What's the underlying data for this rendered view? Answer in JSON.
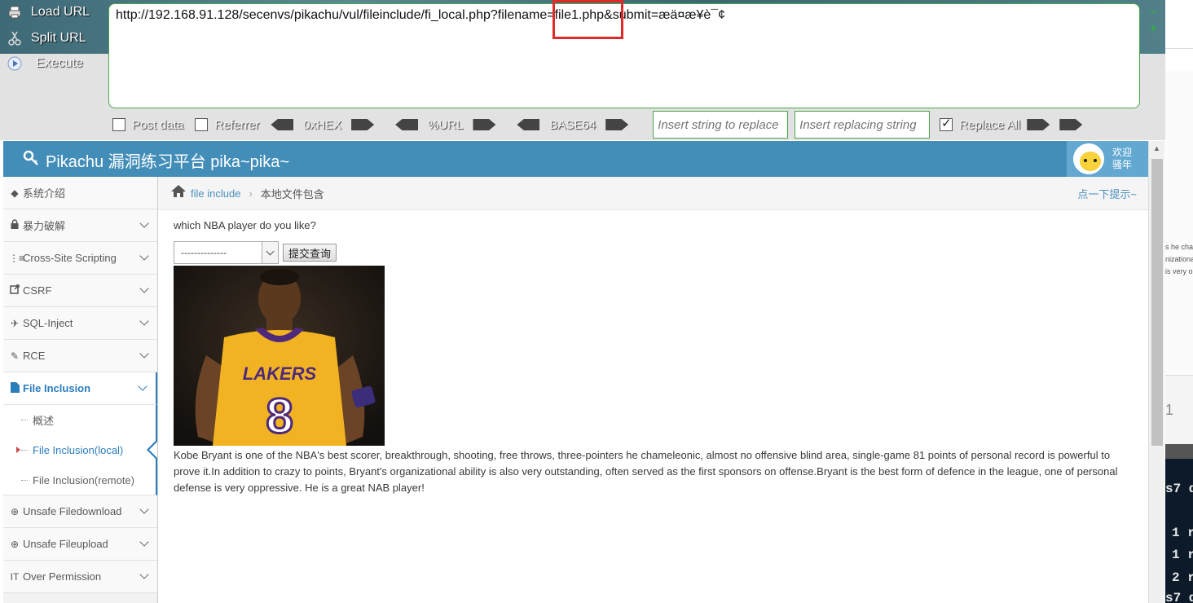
{
  "hackbar": {
    "load_url": "Load URL",
    "split_url": "Split URL",
    "execute": "Execute",
    "url_value": "http://192.168.91.128/secenvs/pikachu/vul/fileinclude/fi_local.php?filename=file1.php&submit=æä¤æ¥è¯¢",
    "post_data": "Post data",
    "referrer": "Referrer",
    "hex": "0xHEX",
    "url_enc": "%URL",
    "base64": "BASE64",
    "replace_placeholder": "Insert string to replace",
    "replacing_placeholder": "Insert replacing string",
    "replace_all": "Replace All",
    "post_data_checked": false,
    "referrer_checked": false,
    "replace_all_checked": true
  },
  "header": {
    "brand": "Pikachu 漏洞练习平台 pika~pika~",
    "welcome_line1": "欢迎",
    "welcome_line2": "骚年"
  },
  "sidebar": {
    "items": [
      {
        "label": "系统介绍",
        "icon": "tags-icon"
      },
      {
        "label": "暴力破解",
        "icon": "lock-icon"
      },
      {
        "label": "Cross-Site Scripting",
        "icon": "list-icon"
      },
      {
        "label": "CSRF",
        "icon": "share-icon"
      },
      {
        "label": "SQL-Inject",
        "icon": "plane-icon"
      },
      {
        "label": "RCE",
        "icon": "pencil-icon"
      },
      {
        "label": "File Inclusion",
        "icon": "file-icon"
      },
      {
        "label": "Unsafe Filedownload",
        "icon": "download-icon"
      },
      {
        "label": "Unsafe Fileupload",
        "icon": "upload-icon"
      },
      {
        "label": "Over Permission",
        "icon": "text-height-icon"
      }
    ],
    "sub_items": [
      {
        "label": "概述"
      },
      {
        "label": "File Inclusion(local)"
      },
      {
        "label": "File Inclusion(remote)"
      }
    ]
  },
  "breadcrumb": {
    "link": "file include",
    "current": "本地文件包含",
    "hint": "点一下提示~"
  },
  "content": {
    "question": "which NBA player do you like?",
    "select_value": "--------------",
    "submit_label": "提交查询",
    "description": "Kobe Bryant is one of the NBA's best scorer, breakthrough, shooting, free throws, three-pointers he chameleonic, almost no offensive blind area, single-game 81 points of personal record is powerful to prove it.In addition to crazy to points, Bryant's organizational ability is also very outstanding, often served as the first sponsors on offense.Bryant is the best form of defence in the league, one of personal defense is very oppressive. He is a great NAB player!",
    "jersey_team": "LAKERS",
    "jersey_number": "8"
  },
  "right_strip": {
    "snippet_lines": [
      "s he cha",
      "nizationa",
      "is very o"
    ],
    "mid_text": "1",
    "term_lines": [
      "s7 d",
      "1 r",
      "1 r",
      "2 r",
      "s7 d"
    ]
  }
}
